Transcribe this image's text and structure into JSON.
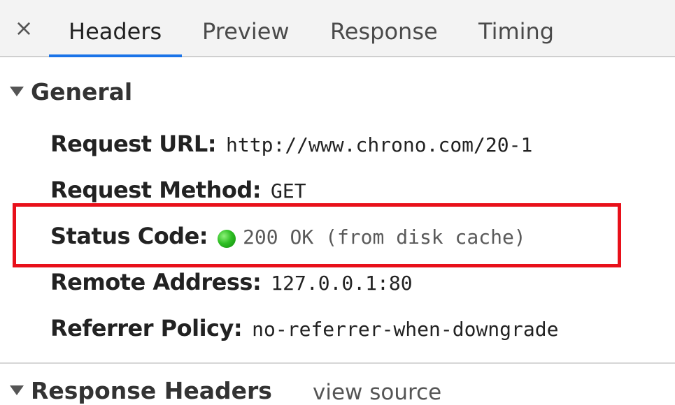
{
  "tabs": {
    "close_symbol": "×",
    "headers": "Headers",
    "preview": "Preview",
    "response": "Response",
    "timing": "Timing",
    "active": "Headers",
    "active_underline_color": "#1a73e8"
  },
  "general": {
    "title": "General",
    "request_url_label": "Request URL:",
    "request_url_value": "http://www.chrono.com/20-1",
    "request_method_label": "Request Method:",
    "request_method_value": "GET",
    "status_code_label": "Status Code:",
    "status_code_value": "200 OK (from disk cache)",
    "status_indicator_color": "#2fbf24",
    "remote_address_label": "Remote Address:",
    "remote_address_value": "127.0.0.1:80",
    "referrer_policy_label": "Referrer Policy:",
    "referrer_policy_value": "no-referrer-when-downgrade"
  },
  "highlight": {
    "color": "#e8101a"
  },
  "response_headers": {
    "title": "Response Headers",
    "view_source": "view source"
  }
}
